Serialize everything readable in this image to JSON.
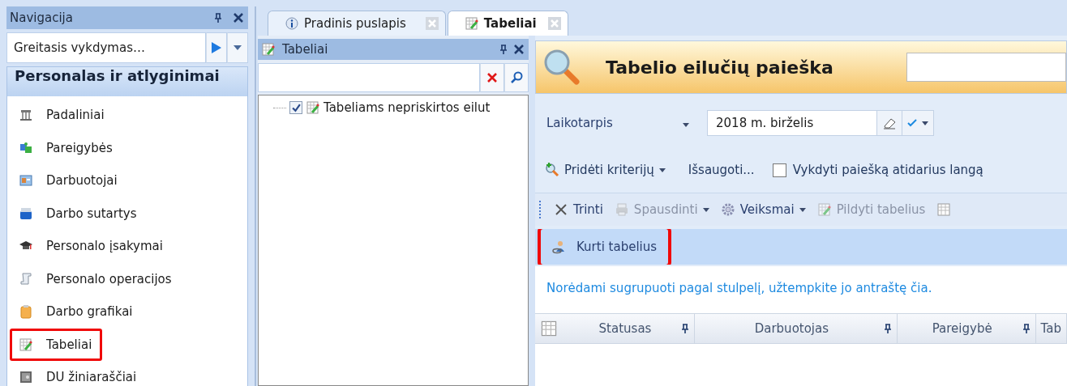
{
  "navigation": {
    "title": "Navigacija",
    "quick_run": {
      "placeholder": "Greitasis vykdymas…"
    },
    "section": "Personalas ir atlyginimai",
    "items": [
      {
        "label": "Padaliniai",
        "highlighted": false
      },
      {
        "label": "Pareigybės",
        "highlighted": false
      },
      {
        "label": "Darbuotojai",
        "highlighted": false
      },
      {
        "label": "Darbo sutartys",
        "highlighted": false
      },
      {
        "label": "Personalo įsakymai",
        "highlighted": false
      },
      {
        "label": "Personalo operacijos",
        "highlighted": false
      },
      {
        "label": "Darbo grafikai",
        "highlighted": false
      },
      {
        "label": "Tabeliai",
        "highlighted": true
      },
      {
        "label": "DU žiniaraščiai",
        "highlighted": false
      }
    ]
  },
  "tabs": [
    {
      "label": "Pradinis puslapis",
      "selected": false
    },
    {
      "label": "Tabeliai",
      "selected": true
    }
  ],
  "tree_panel": {
    "title": "Tabeliai",
    "items": [
      {
        "label": "Tabeliams nepriskirtos eilut",
        "checked": true
      }
    ]
  },
  "search": {
    "title": "Tabelio eilučių paieška",
    "period": {
      "label": "Laikotarpis",
      "value": "2018 m. birželis"
    },
    "add_criteria": "Pridėti kriterijų",
    "save": "Išsaugoti...",
    "run_on_open": {
      "label": "Vykdyti paiešką atidarius langą",
      "checked": false
    }
  },
  "toolbar": [
    {
      "label": "Trinti",
      "disabled": false,
      "dropdown": false
    },
    {
      "label": "Spausdinti",
      "disabled": true,
      "dropdown": true
    },
    {
      "label": "Veiksmai",
      "disabled": false,
      "dropdown": true
    },
    {
      "label": "Pildyti tabelius",
      "disabled": true,
      "dropdown": false
    }
  ],
  "toolbar2": [
    {
      "label": "Kurti tabelius",
      "highlighted": true
    }
  ],
  "group_hint": "Norėdami sugrupuoti pagal stulpelį, užtempkite jo antraštę čia.",
  "table": {
    "columns": [
      "Statusas",
      "Darbuotojas",
      "Pareigybė",
      "Tab"
    ]
  }
}
